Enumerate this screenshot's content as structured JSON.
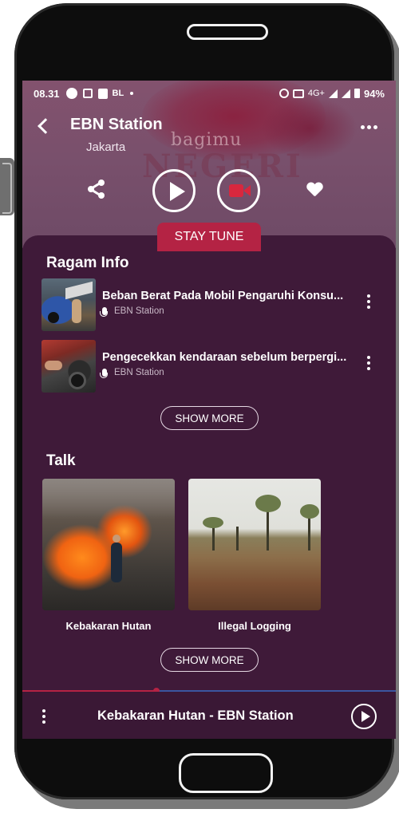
{
  "status_bar": {
    "time": "08.31",
    "carrier_tag": "BL",
    "network": "4G+",
    "battery": "94%"
  },
  "header": {
    "title": "EBN Station",
    "subtitle": "Jakarta",
    "watermark_line1": "bagimu",
    "watermark_line2": "NEGERI"
  },
  "controls": {
    "share_icon": "share-icon",
    "play_icon": "play-icon",
    "video_icon": "video-camera-icon",
    "favorite_icon": "heart-icon",
    "badge": "STAY TUNE"
  },
  "ragam_info": {
    "title": "Ragam Info",
    "items": [
      {
        "title": "Beban Berat Pada Mobil Pengaruhi Konsu...",
        "source": "EBN Station"
      },
      {
        "title": "Pengecekkan kendaraan sebelum berpergi...",
        "source": "EBN Station"
      }
    ],
    "show_more": "SHOW MORE"
  },
  "talk": {
    "title": "Talk",
    "items": [
      {
        "label": "Kebakaran Hutan"
      },
      {
        "label": "Illegal Logging"
      }
    ],
    "show_more": "SHOW MORE"
  },
  "player": {
    "now_playing": "Kebakaran Hutan - EBN Station",
    "progress": 0.36
  },
  "colors": {
    "background": "#3f1a39",
    "accent": "#b42344",
    "progress_track": "#3a56a0"
  }
}
